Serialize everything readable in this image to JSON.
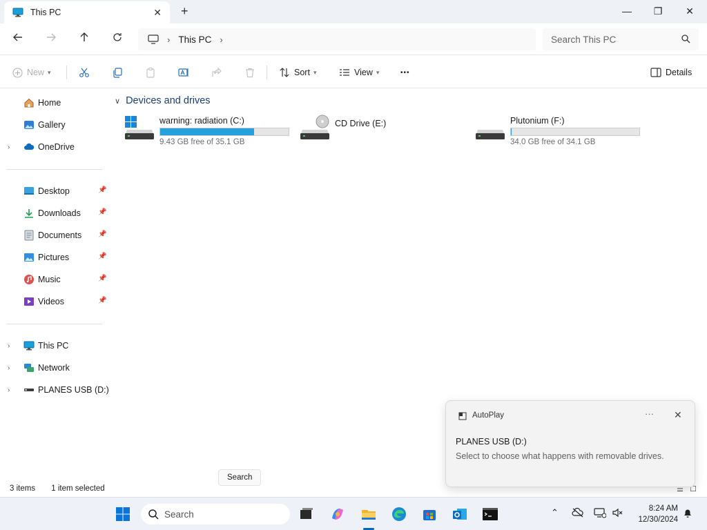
{
  "window": {
    "tab_title": "This PC",
    "new_tab": "+",
    "minimize": "—",
    "maximize": "❐",
    "close": "✕"
  },
  "address": {
    "segment": "This PC",
    "search_placeholder": "Search This PC"
  },
  "commands": {
    "new": "New",
    "sort": "Sort",
    "view": "View",
    "more": "•••",
    "details": "Details"
  },
  "sidebar": {
    "quick": [
      {
        "label": "Home",
        "icon": "home-icon"
      },
      {
        "label": "Gallery",
        "icon": "gallery-icon"
      },
      {
        "label": "OneDrive",
        "icon": "onedrive-icon"
      }
    ],
    "pinned": [
      {
        "label": "Desktop",
        "icon": "desktop-icon"
      },
      {
        "label": "Downloads",
        "icon": "downloads-icon"
      },
      {
        "label": "Documents",
        "icon": "documents-icon"
      },
      {
        "label": "Pictures",
        "icon": "pictures-icon"
      },
      {
        "label": "Music",
        "icon": "music-icon"
      },
      {
        "label": "Videos",
        "icon": "videos-icon"
      }
    ],
    "locations": [
      {
        "label": "This PC",
        "icon": "computer-icon"
      },
      {
        "label": "Network",
        "icon": "network-icon"
      },
      {
        "label": "PLANES USB (D:)",
        "icon": "usb-drive-icon"
      }
    ]
  },
  "content": {
    "group_title": "Devices and drives",
    "drives": [
      {
        "name": "warning: radiation (C:)",
        "free": "9.43 GB free of 35.1 GB",
        "used_fraction": 0.73
      },
      {
        "name": "CD Drive (E:)"
      },
      {
        "name": "Plutonium (F:)",
        "free": "34.0 GB free of 34.1 GB",
        "used_fraction": 0.003
      }
    ]
  },
  "status": {
    "items": "3 items",
    "selected": "1 item selected"
  },
  "tooltip": "Search",
  "toast": {
    "app": "AutoPlay",
    "more": "···",
    "title": "PLANES USB (D:)",
    "body": "Select to choose what happens with removable drives."
  },
  "taskbar": {
    "search_placeholder": "Search",
    "time": "8:24 AM",
    "date": "12/30/2024"
  },
  "colors": {
    "accent": "#0067c0",
    "progress": "#26a0da"
  }
}
